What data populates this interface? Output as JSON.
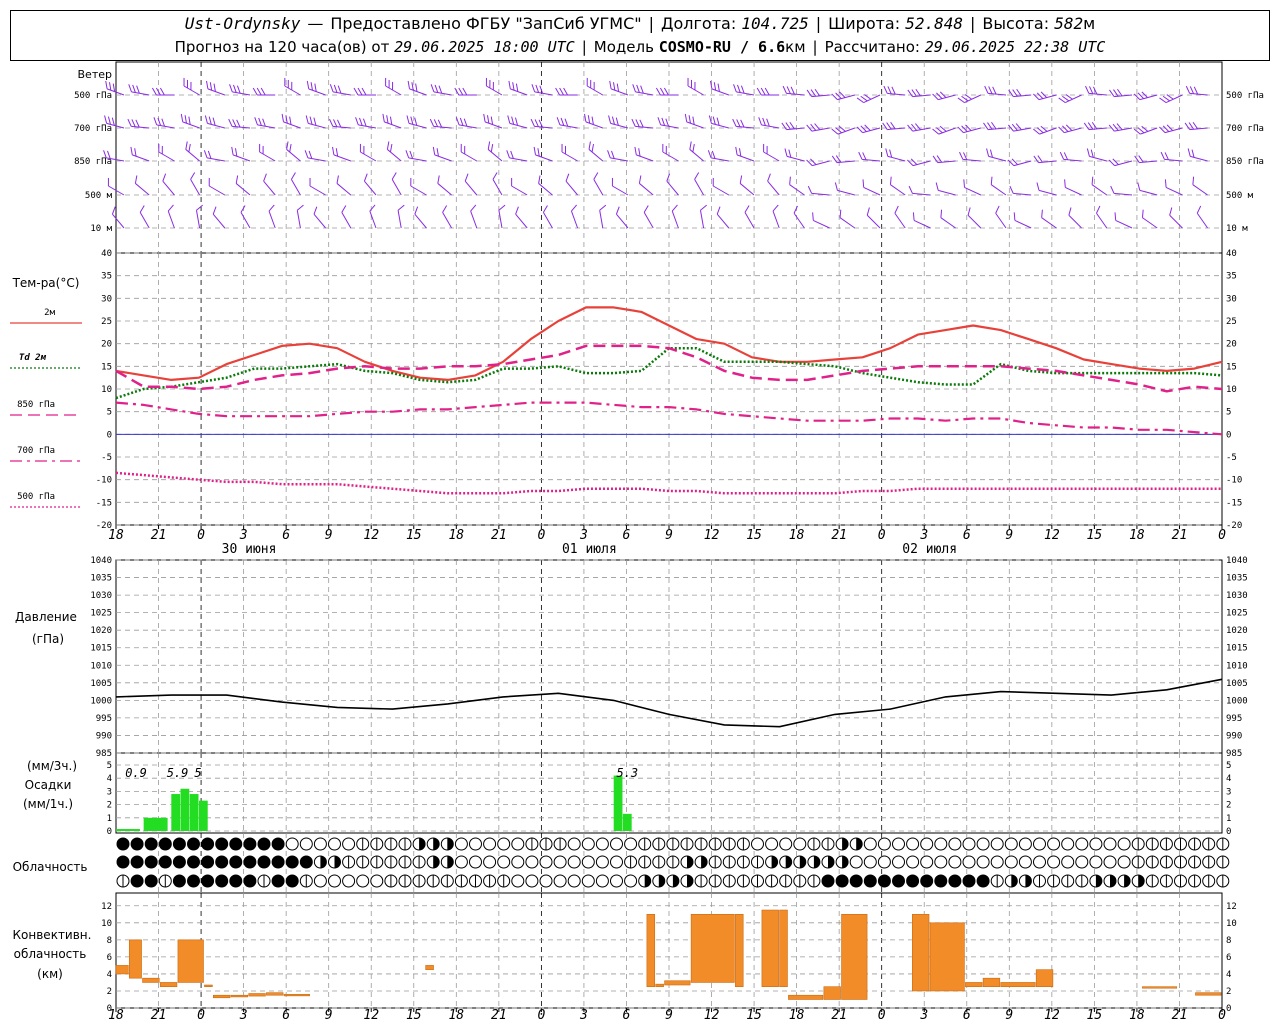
{
  "header": {
    "station": "Ust-Ordynsky",
    "provided_by": "Предоставлено ФГБУ \"ЗапСиб УГМС\"",
    "lon_label": "Долгота:",
    "lon": "104.725",
    "lat_label": "Широта:",
    "lat": "52.848",
    "alt_label": "Высота:",
    "alt": "582",
    "alt_unit": "м",
    "forecast_label": "Прогноз на 120 часа(ов) от",
    "forecast_start": "29.06.2025 18:00 UTC",
    "model_label": "Модель",
    "model": "COSMO-RU / 6.6",
    "model_unit": "км",
    "calc_label": "Рассчитано:",
    "calc_time": "29.06.2025 22:38 UTC"
  },
  "colors": {
    "t2m": "#e8413a",
    "td2m": "#0b7a0b",
    "t850": "#e0218a",
    "t700": "#e0218a",
    "t500": "#e0218a",
    "zero": "#3333cc",
    "wind": "#8a2be2",
    "pressure": "#000000",
    "precip": "#22dd22",
    "conv": "#f28c28",
    "grid": "#9a9a9a"
  },
  "time_axis": {
    "ticks": [
      "18",
      "21",
      "0",
      "3",
      "6",
      "9",
      "12",
      "15",
      "18",
      "21",
      "0",
      "3",
      "6",
      "9",
      "12",
      "15",
      "18",
      "21",
      "0",
      "3",
      "6",
      "9",
      "12",
      "15",
      "18",
      "21",
      "0"
    ],
    "day_labels": [
      {
        "text": "30 июня",
        "tick": 2
      },
      {
        "text": "01 июля",
        "tick": 10
      },
      {
        "text": "02 июля",
        "tick": 18
      }
    ],
    "day_lines": [
      2,
      10,
      18,
      26
    ]
  },
  "wind_panel": {
    "title": "Ветер",
    "levels": [
      "500 гПа",
      "700 гПа",
      "850 гПа",
      "500 м",
      "10  м"
    ],
    "icon": "wind-barb-icon"
  },
  "temp_panel": {
    "title": "Тем-ра(°C)",
    "legend": [
      {
        "label": "2м",
        "key": "t2m",
        "style": "solid"
      },
      {
        "label": "Td  2м",
        "key": "td2m",
        "style": "dotted"
      },
      {
        "label": "850 гПа",
        "key": "t850",
        "style": "dashed"
      },
      {
        "label": "700 гПа",
        "key": "t700",
        "style": "dashdot"
      },
      {
        "label": "500 гПа",
        "key": "t500",
        "style": "dotted"
      }
    ],
    "ticks": [
      "40",
      "35",
      "30",
      "25",
      "20",
      "15",
      "10",
      "5",
      "0",
      "-5",
      "-10",
      "-15",
      "-20"
    ]
  },
  "pressure_panel": {
    "title": "Давление",
    "unit": "(гПа)",
    "ticks": [
      "1040",
      "1035",
      "1030",
      "1025",
      "1020",
      "1015",
      "1010",
      "1005",
      "1000",
      "995",
      "990",
      "985"
    ]
  },
  "precip_panel": {
    "unit_3h": "(мм/3ч.)",
    "title": "Осадки",
    "unit_1h": "(мм/1ч.)",
    "ticks": [
      "5",
      "4",
      "3",
      "2",
      "1",
      "0"
    ],
    "totals": [
      {
        "text": "0.9",
        "hour": 1
      },
      {
        "text": "5.9",
        "hour": 5.5
      },
      {
        "text": "5",
        "hour": 8.5
      },
      {
        "text": "5.3",
        "hour": 54.3
      }
    ]
  },
  "cloud_panel": {
    "title": "Облачность",
    "icon": "cloud-cover-icon"
  },
  "conv_panel": {
    "title1": "Конвективн.",
    "title2": "облачность",
    "unit": "(км)",
    "ticks": [
      "12",
      "10",
      "8",
      "6",
      "4",
      "2",
      "0"
    ]
  },
  "chart_data": [
    {
      "type": "line",
      "title": "Тем-ра(°C)",
      "ylim": [
        -20,
        40
      ],
      "x_unit": "hours from 29.06.2025 18:00 UTC",
      "x": [
        0,
        3,
        6,
        9,
        12,
        15,
        18,
        21,
        24,
        27,
        30,
        33,
        36,
        39,
        42,
        45,
        48,
        51,
        54,
        57,
        60,
        63,
        66,
        69,
        72,
        75,
        78,
        81,
        84,
        87,
        90,
        93,
        96,
        99,
        102,
        105,
        108,
        111,
        114,
        117,
        120
      ],
      "series": [
        {
          "name": "2м",
          "values": [
            14,
            13,
            12,
            12.5,
            15.5,
            17.5,
            19.5,
            20,
            19,
            16,
            14,
            12.5,
            12,
            13,
            16,
            21,
            25,
            28,
            28,
            27,
            24,
            21,
            20,
            17,
            16,
            16,
            16.5,
            17,
            19,
            22,
            23,
            24,
            23,
            21,
            19,
            16.5,
            15.5,
            14.5,
            14,
            14.5,
            16
          ]
        },
        {
          "name": "Td  2м",
          "values": [
            8,
            10,
            10.5,
            11.5,
            12.5,
            14.5,
            14.5,
            15,
            15.5,
            14,
            13.5,
            12,
            11.5,
            12,
            14.5,
            14.5,
            15,
            13.5,
            13.5,
            14,
            19,
            19,
            16,
            16,
            16,
            15.5,
            15,
            13.5,
            12.5,
            11.5,
            11,
            11,
            15.5,
            14,
            13.5,
            13.5,
            13.5,
            13.5,
            13.5,
            13.5,
            13
          ]
        },
        {
          "name": "850 гПа",
          "values": [
            14,
            10.5,
            10.5,
            10,
            10.5,
            12,
            13,
            13.5,
            14.5,
            15,
            14.5,
            14.5,
            15,
            15,
            15.5,
            16.5,
            17.5,
            19.5,
            19.5,
            19.5,
            19,
            17,
            14,
            12.5,
            12,
            12,
            13,
            14,
            14.5,
            15,
            15,
            15,
            15,
            14.5,
            14,
            13,
            12,
            11,
            9.5,
            10.5,
            10
          ]
        },
        {
          "name": "700 гПа",
          "values": [
            7,
            6.5,
            5.5,
            4.5,
            4,
            4,
            4,
            4,
            4.5,
            5,
            5,
            5.5,
            5.5,
            6,
            6.5,
            7,
            7,
            7,
            6.5,
            6,
            6,
            5.5,
            4.5,
            4,
            3.5,
            3,
            3,
            3,
            3.5,
            3.5,
            3,
            3.5,
            3.5,
            2.5,
            2,
            1.5,
            1.5,
            1,
            1,
            0.5,
            0
          ]
        },
        {
          "name": "500 гПа",
          "values": [
            -8.5,
            -9,
            -9.5,
            -10,
            -10.5,
            -10.5,
            -11,
            -11,
            -11,
            -11.5,
            -12,
            -12.5,
            -13,
            -13,
            -13,
            -12.5,
            -12.5,
            -12,
            -12,
            -12,
            -12.5,
            -12.5,
            -13,
            -13,
            -13,
            -13,
            -13,
            -12.5,
            -12.5,
            -12,
            -12,
            -12,
            -12,
            -12,
            -12,
            -12,
            -12,
            -12,
            -12,
            -12,
            -12
          ]
        }
      ]
    },
    {
      "type": "line",
      "title": "Давление",
      "ylabel": "(гПа)",
      "ylim": [
        985,
        1040
      ],
      "x": [
        0,
        6,
        12,
        18,
        24,
        30,
        36,
        42,
        48,
        54,
        60,
        66,
        72,
        78,
        84,
        90,
        96,
        102,
        108,
        114,
        120
      ],
      "series": [
        {
          "values": [
            1001,
            1001.5,
            1001.5,
            999.5,
            998,
            997.5,
            999,
            1001,
            1002,
            1000,
            996,
            993,
            992.5,
            996,
            997.5,
            1001,
            1002.5,
            1002,
            1001.5,
            1003,
            1006
          ]
        }
      ]
    },
    {
      "type": "bar",
      "title": "Осадки",
      "ylabel": "(мм/3ч.)",
      "ylim": [
        0,
        5
      ],
      "x": [
        0,
        3,
        6,
        7,
        8,
        9,
        10,
        54,
        55
      ],
      "values": [
        0.15,
        1,
        2.8,
        3.2,
        2.8,
        2.3,
        0,
        4.2,
        1.3
      ]
    },
    {
      "type": "bar",
      "title": "Конвективн. облачность",
      "ylabel": "(км)",
      "ylim": [
        0,
        13
      ],
      "bars": [
        [
          0,
          1.5,
          4,
          5
        ],
        [
          1.5,
          3,
          3.5,
          8
        ],
        [
          3,
          5,
          3,
          3.5
        ],
        [
          5,
          7,
          2.5,
          3
        ],
        [
          7,
          10,
          3,
          8
        ],
        [
          10,
          11,
          2.5,
          2.7
        ],
        [
          11,
          13,
          1.2,
          1.5
        ],
        [
          13,
          15,
          1.3,
          1.5
        ],
        [
          15,
          17,
          1.4,
          1.7
        ],
        [
          17,
          19,
          1.5,
          1.8
        ],
        [
          19,
          22,
          1.5,
          1.6
        ],
        [
          35,
          36,
          4.5,
          5
        ],
        [
          60,
          61,
          2.5,
          11
        ],
        [
          61,
          62,
          2.5,
          2.8
        ],
        [
          62,
          65,
          2.7,
          3.2
        ],
        [
          65,
          70,
          3,
          11
        ],
        [
          70,
          71,
          2.5,
          11
        ],
        [
          73,
          75,
          2.5,
          11.5
        ],
        [
          75,
          76,
          2.5,
          11.5
        ],
        [
          76,
          80,
          1,
          1.5
        ],
        [
          80,
          82,
          1,
          2.5
        ],
        [
          82,
          85,
          1,
          11
        ],
        [
          90,
          92,
          2,
          11
        ],
        [
          92,
          96,
          2,
          10
        ],
        [
          96,
          98,
          2.5,
          3
        ],
        [
          98,
          100,
          2.5,
          3.5
        ],
        [
          100,
          104,
          2.5,
          3
        ],
        [
          104,
          106,
          2.5,
          4.5
        ],
        [
          116,
          120,
          2.5,
          2.5
        ],
        [
          122,
          125,
          1.5,
          1.8
        ]
      ]
    }
  ]
}
